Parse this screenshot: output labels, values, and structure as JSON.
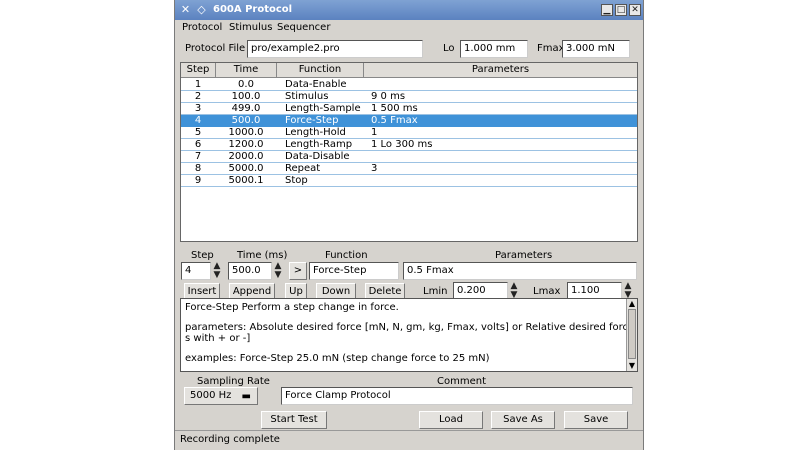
{
  "window": {
    "title": "600A Protocol"
  },
  "menu": {
    "items": [
      "Protocol",
      "Stimulus",
      "Sequencer"
    ]
  },
  "protocol_file": {
    "label": "Protocol File",
    "value": "pro/example2.pro"
  },
  "lo": {
    "label": "Lo",
    "value": "1.000 mm"
  },
  "fmax": {
    "label": "Fmax",
    "value": "3.000 mN"
  },
  "table": {
    "headers": [
      "Step",
      "Time",
      "Function",
      "Parameters"
    ],
    "rows": [
      {
        "step": "1",
        "time": "0.0",
        "function": "Data-Enable",
        "params": ""
      },
      {
        "step": "2",
        "time": "100.0",
        "function": "Stimulus",
        "params": "9  0 ms"
      },
      {
        "step": "3",
        "time": "499.0",
        "function": "Length-Sample",
        "params": "1  500 ms"
      },
      {
        "step": "4",
        "time": "500.0",
        "function": "Force-Step",
        "params": "0.5 Fmax"
      },
      {
        "step": "5",
        "time": "1000.0",
        "function": "Length-Hold",
        "params": "1"
      },
      {
        "step": "6",
        "time": "1200.0",
        "function": "Length-Ramp",
        "params": " 1 Lo  300 ms"
      },
      {
        "step": "7",
        "time": "2000.0",
        "function": "Data-Disable",
        "params": ""
      },
      {
        "step": "8",
        "time": "5000.0",
        "function": "Repeat",
        "params": "3"
      },
      {
        "step": "9",
        "time": "5000.1",
        "function": "Stop",
        "params": ""
      }
    ],
    "selected_row": 3
  },
  "editor": {
    "step_label": "Step",
    "step_value": "4",
    "time_label": "Time (ms)",
    "time_value": "500.0",
    "arrow_label": ">",
    "function_label": "Function",
    "function_value": "Force-Step",
    "params_label": "Parameters",
    "params_value": "0.5 Fmax"
  },
  "actions": {
    "insert": "Insert",
    "append": "Append",
    "up": "Up",
    "down": "Down",
    "delete": "Delete",
    "lmin_label": "Lmin",
    "lmin_value": "0.200",
    "lmax_label": "Lmax",
    "lmax_value": "1.100"
  },
  "help": {
    "lines": [
      "Force-Step      Perform a step change in force.",
      "",
      "parameters:    Absolute desired force [mN, N, gm, kg, Fmax, volts] or Relative desired force [prefix unit",
      "s with + or -]",
      "",
      "examples:       Force-Step 25.0 mN (step change force to 25 mN)"
    ]
  },
  "sampling": {
    "label": "Sampling Rate",
    "value": "5000 Hz"
  },
  "comment": {
    "label": "Comment",
    "value": "Force Clamp Protocol"
  },
  "bottom": {
    "start_test": "Start Test",
    "load": "Load",
    "save_as": "Save As",
    "save": "Save"
  },
  "status": {
    "text": "Recording complete"
  }
}
